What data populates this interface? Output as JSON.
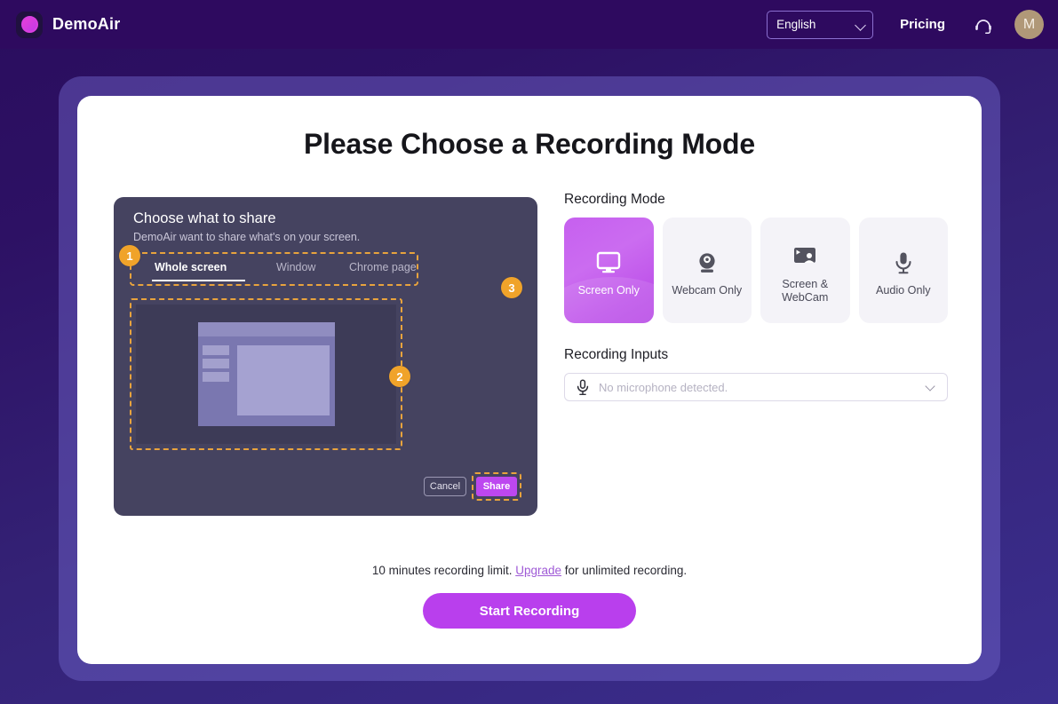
{
  "header": {
    "brand_name": "DemoAir",
    "brand_logo_icon": "demoair-logo-icon",
    "language_value": "English",
    "language_options": [
      "English"
    ],
    "pricing_label": "Pricing",
    "support_icon": "headset-support-icon",
    "avatar_initial": "M"
  },
  "page": {
    "title": "Please Choose a Recording Mode"
  },
  "share_dialog": {
    "title": "Choose what to share",
    "subtitle": "DemoAir want to share what's on your screen.",
    "tabs": [
      {
        "label": "Whole screen",
        "active": true
      },
      {
        "label": "Window",
        "active": false
      },
      {
        "label": "Chrome page",
        "active": false
      }
    ],
    "cancel_label": "Cancel",
    "share_label": "Share",
    "badges": [
      "1",
      "2",
      "3"
    ],
    "preview_icon": "screen-preview-thumbnail"
  },
  "recording_mode": {
    "label": "Recording Mode",
    "options": [
      {
        "label": "Screen Only",
        "icon": "monitor-icon",
        "active": true
      },
      {
        "label": "Webcam Only",
        "icon": "webcam-icon",
        "active": false
      },
      {
        "label": "Screen & WebCam",
        "icon": "screen-webcam-icon",
        "active": false
      },
      {
        "label": "Audio Only",
        "icon": "microphone-icon",
        "active": false
      }
    ]
  },
  "recording_inputs": {
    "label": "Recording Inputs",
    "mic_icon": "microphone-icon",
    "mic_value": "No microphone detected.",
    "mic_options": [
      "No microphone detected."
    ]
  },
  "footer": {
    "limit_prefix": "10 minutes recording limit. ",
    "upgrade_label": "Upgrade",
    "limit_suffix": " for unlimited recording.",
    "start_label": "Start Recording"
  },
  "colors": {
    "accent_purple": "#b93fed",
    "badge_orange": "#f0a32a",
    "dashed_orange": "#e8a33d",
    "header_purple": "#2e0a5f",
    "panel_dark": "#454360",
    "avatar_tan": "#b09878"
  }
}
